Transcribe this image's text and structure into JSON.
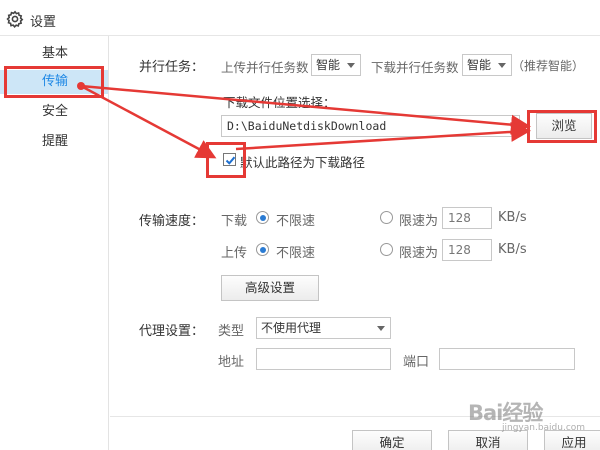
{
  "window": {
    "title": "设置",
    "icon": "gear-icon"
  },
  "sidebar": {
    "items": [
      {
        "label": "基本",
        "active": false
      },
      {
        "label": "传输",
        "active": true
      },
      {
        "label": "安全",
        "active": false
      },
      {
        "label": "提醒",
        "active": false
      }
    ]
  },
  "parallel": {
    "label": "并行任务：",
    "upload_label": "上传并行任务数",
    "upload_value": "智能",
    "download_label": "下载并行任务数",
    "download_value": "智能",
    "hint": "（推荐智能）"
  },
  "download_location": {
    "label": "下载文件位置选择：",
    "path": "D:\\BaiduNetdiskDownload",
    "browse_label": "浏览",
    "default_checkbox_label": "默认此路径为下载路径",
    "default_checked": true
  },
  "speed": {
    "label": "传输速度：",
    "download": {
      "label": "下载",
      "unlimited_label": "不限速",
      "unlimited_selected": true,
      "limit_label": "限速为",
      "limit_value": "128",
      "unit": "KB/s"
    },
    "upload": {
      "label": "上传",
      "unlimited_label": "不限速",
      "unlimited_selected": true,
      "limit_label": "限速为",
      "limit_value": "128",
      "unit": "KB/s"
    },
    "advanced_label": "高级设置"
  },
  "proxy": {
    "label": "代理设置：",
    "type_label": "类型",
    "type_value": "不使用代理",
    "address_label": "地址",
    "address_value": "",
    "port_label": "端口",
    "port_value": ""
  },
  "footer": {
    "ok_label": "确定",
    "cancel_label": "取消",
    "apply_label": "应用"
  },
  "watermark": {
    "text": "Bai经验",
    "subtext": "jingyan.baidu.com"
  },
  "annotation_color": "#e53935",
  "accent_color": "#1e88e5"
}
